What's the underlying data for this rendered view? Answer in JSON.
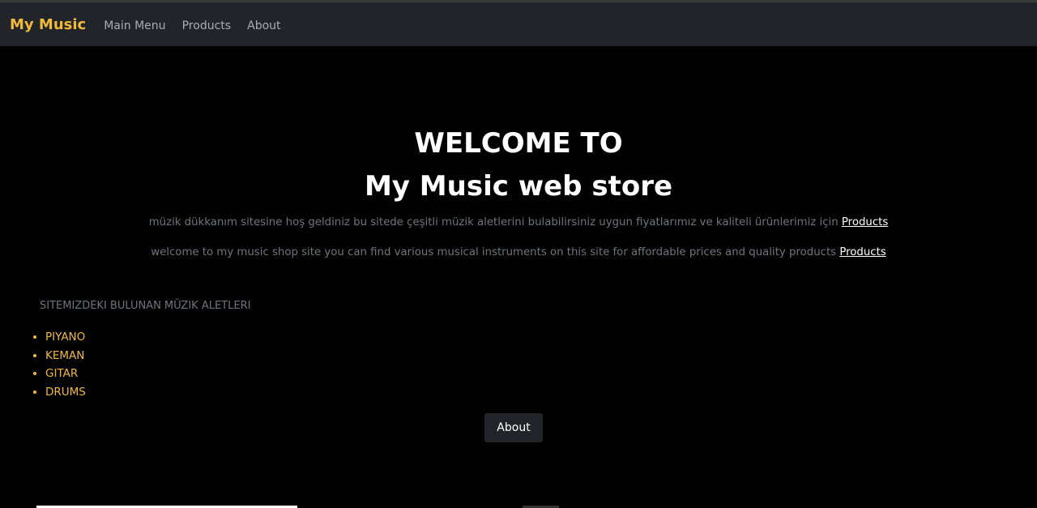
{
  "nav": {
    "brand": "My Music",
    "links": [
      "Main Menu",
      "Products",
      "About"
    ]
  },
  "hero": {
    "line1": "WELCOME TO",
    "line2": "My Music web store",
    "tr_text": "müzik dükkanım sitesine hoş geldiniz bu sitede çeşitli müzik aletlerini bulabilirsiniz uygun fiyatlarımız ve kaliteli ürünlerimiz için",
    "tr_link": "Products",
    "en_text": "welcome to my music shop site you can find various musical instruments on this site for affordable prices and quality products",
    "en_link": "Products"
  },
  "instruments": {
    "title": "SITEMIZDEKI BULUNAN MÜZIK ALETLERI",
    "items": [
      "PIYANO",
      "KEMAN",
      "GITAR",
      "DRUMS"
    ]
  },
  "about_button": "About",
  "colors": {
    "accent": "#f0b93a",
    "navbar": "#212529"
  }
}
